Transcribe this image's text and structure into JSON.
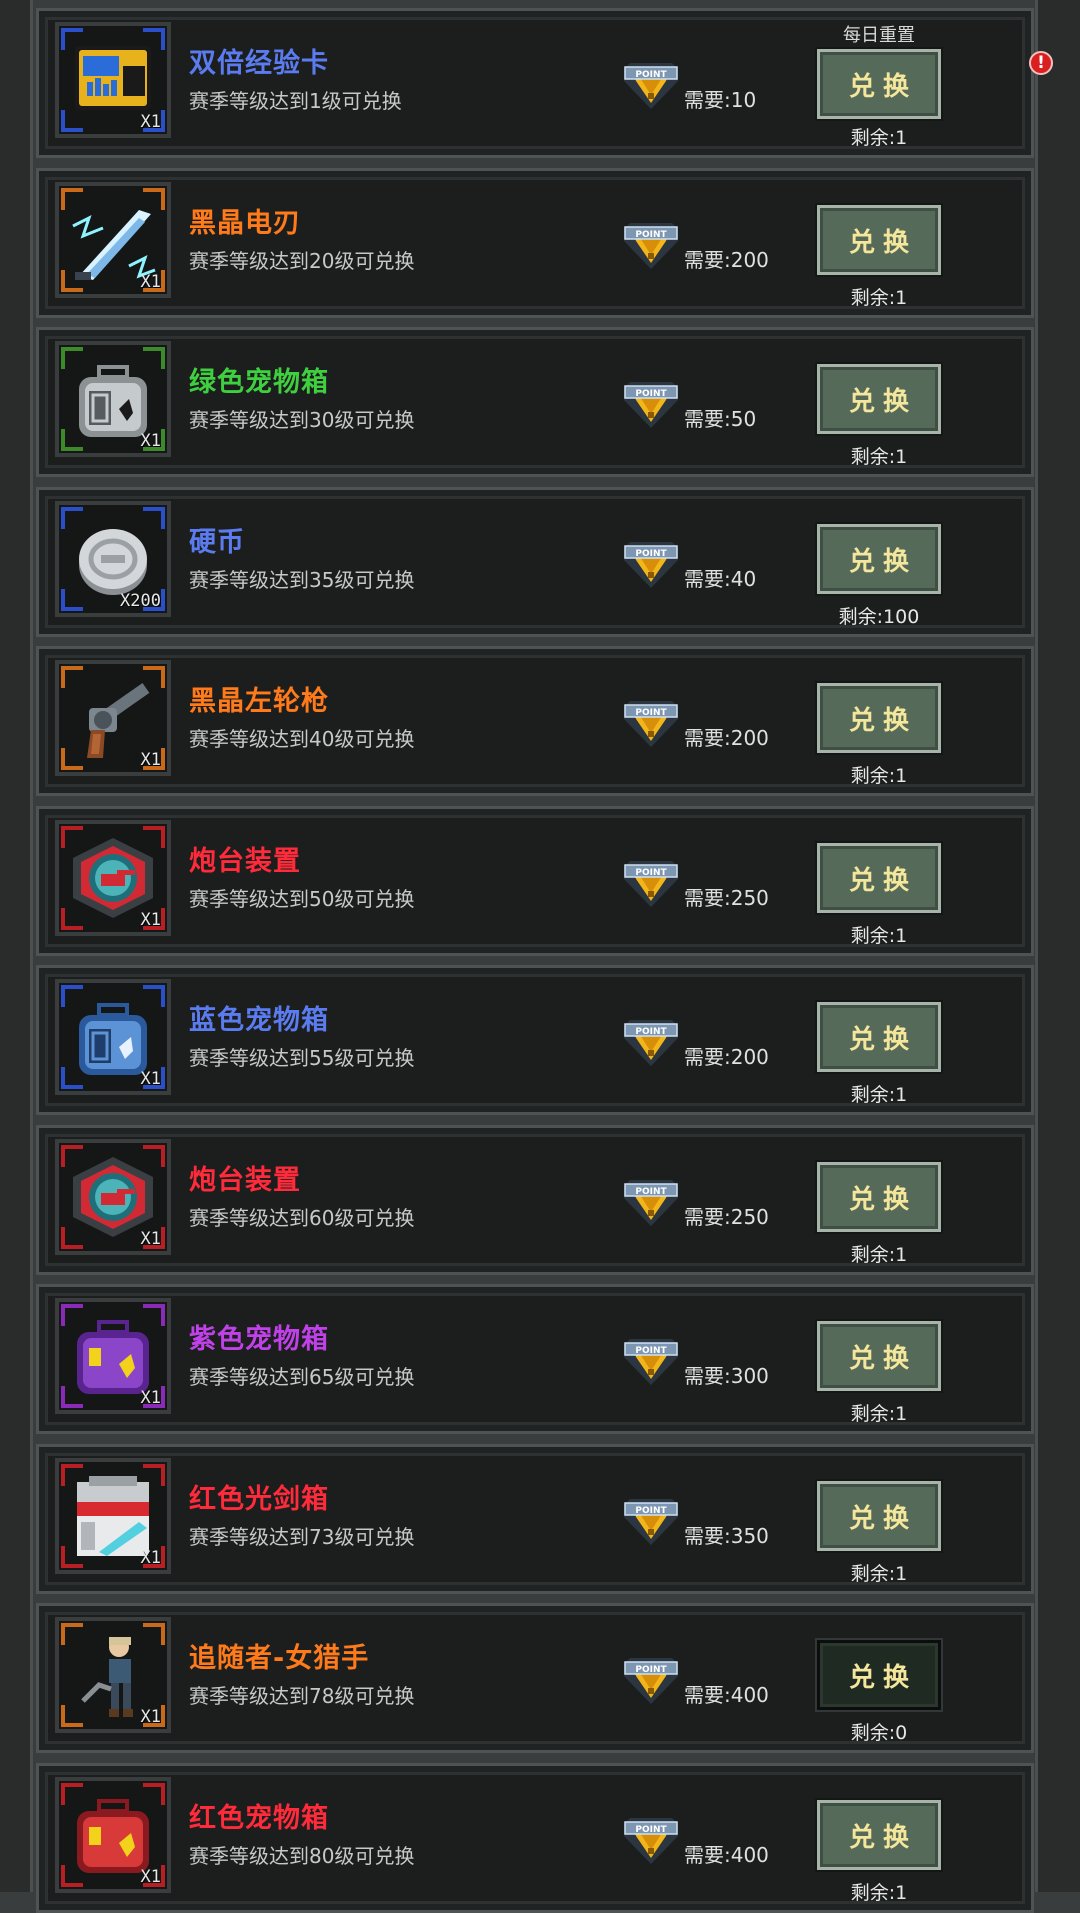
{
  "rows": [
    {
      "name": "双倍经验卡",
      "name_color": "#5b7cf0",
      "requirement": "赛季等级达到1级可兑换",
      "cost": "需要:10",
      "button": "兑换",
      "remaining": "剩余:1",
      "note": "每日重置",
      "quantity": "X1",
      "icon": "exp-card-icon",
      "frame_color": "#2a4fc9",
      "disabled": false
    },
    {
      "name": "黑晶电刃",
      "name_color": "#ff7a1a",
      "requirement": "赛季等级达到20级可兑换",
      "cost": "需要:200",
      "button": "兑换",
      "remaining": "剩余:1",
      "quantity": "X1",
      "icon": "lightning-blade-icon",
      "frame_color": "#c86a1a",
      "disabled": false
    },
    {
      "name": "绿色宠物箱",
      "name_color": "#3fd03f",
      "requirement": "赛季等级达到30级可兑换",
      "cost": "需要:50",
      "button": "兑换",
      "remaining": "剩余:1",
      "quantity": "X1",
      "icon": "green-pet-crate-icon",
      "frame_color": "#3d8a2a",
      "disabled": false
    },
    {
      "name": "硬币",
      "name_color": "#5b7cf0",
      "requirement": "赛季等级达到35级可兑换",
      "cost": "需要:40",
      "button": "兑换",
      "remaining": "剩余:100",
      "quantity": "X200",
      "icon": "coin-icon",
      "frame_color": "#2a4fc9",
      "disabled": false
    },
    {
      "name": "黑晶左轮枪",
      "name_color": "#ff7a1a",
      "requirement": "赛季等级达到40级可兑换",
      "cost": "需要:200",
      "button": "兑换",
      "remaining": "剩余:1",
      "quantity": "X1",
      "icon": "revolver-icon",
      "frame_color": "#c86a1a",
      "disabled": false
    },
    {
      "name": "炮台装置",
      "name_color": "#ff2a3a",
      "requirement": "赛季等级达到50级可兑换",
      "cost": "需要:250",
      "button": "兑换",
      "remaining": "剩余:1",
      "quantity": "X1",
      "icon": "turret-device-icon",
      "frame_color": "#b81f24",
      "disabled": false
    },
    {
      "name": "蓝色宠物箱",
      "name_color": "#5b7cf0",
      "requirement": "赛季等级达到55级可兑换",
      "cost": "需要:200",
      "button": "兑换",
      "remaining": "剩余:1",
      "quantity": "X1",
      "icon": "blue-pet-crate-icon",
      "frame_color": "#2a4fc9",
      "disabled": false
    },
    {
      "name": "炮台装置",
      "name_color": "#ff2a3a",
      "requirement": "赛季等级达到60级可兑换",
      "cost": "需要:250",
      "button": "兑换",
      "remaining": "剩余:1",
      "quantity": "X1",
      "icon": "turret-device-icon",
      "frame_color": "#b81f24",
      "disabled": false
    },
    {
      "name": "紫色宠物箱",
      "name_color": "#c041e8",
      "requirement": "赛季等级达到65级可兑换",
      "cost": "需要:300",
      "button": "兑换",
      "remaining": "剩余:1",
      "quantity": "X1",
      "icon": "purple-pet-crate-icon",
      "frame_color": "#8a2ab8",
      "disabled": false
    },
    {
      "name": "红色光剑箱",
      "name_color": "#ff2a3a",
      "requirement": "赛季等级达到73级可兑换",
      "cost": "需要:350",
      "button": "兑换",
      "remaining": "剩余:1",
      "quantity": "X1",
      "icon": "red-lightsaber-crate-icon",
      "frame_color": "#b81f24",
      "disabled": false
    },
    {
      "name": "追随者-女猎手",
      "name_color": "#ff7a1a",
      "requirement": "赛季等级达到78级可兑换",
      "cost": "需要:400",
      "button": "兑换",
      "remaining": "剩余:0",
      "quantity": "X1",
      "icon": "huntress-follower-icon",
      "frame_color": "#c86a1a",
      "disabled": true
    },
    {
      "name": "红色宠物箱",
      "name_color": "#ff2a3a",
      "requirement": "赛季等级达到80级可兑换",
      "cost": "需要:400",
      "button": "兑换",
      "remaining": "剩余:1",
      "quantity": "X1",
      "icon": "red-pet-crate-icon",
      "frame_color": "#b81f24",
      "disabled": false
    }
  ],
  "alert_badge": "!",
  "badge_text": "POINT"
}
